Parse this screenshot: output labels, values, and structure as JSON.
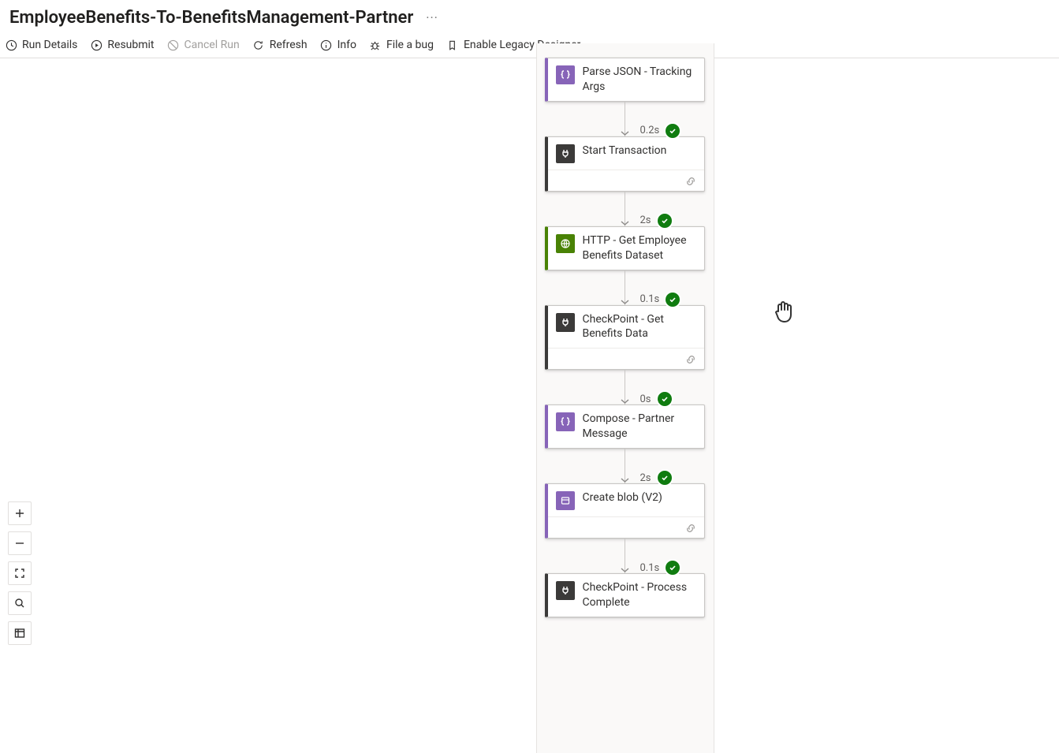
{
  "title": "EmployeeBenefits-To-BenefitsManagement-Partner",
  "toolbar": {
    "run_details": "Run Details",
    "resubmit": "Resubmit",
    "cancel_run": "Cancel Run",
    "refresh": "Refresh",
    "info": "Info",
    "file_bug": "File a bug",
    "enable_legacy": "Enable Legacy Designer"
  },
  "nodes": {
    "n0": {
      "title": "Parse JSON - Tracking Args"
    },
    "n1": {
      "title": "Start Transaction"
    },
    "n2": {
      "title": "HTTP - Get Employee Benefits Dataset"
    },
    "n3": {
      "title": "CheckPoint - Get Benefits Data"
    },
    "n4": {
      "title": "Compose - Partner Message"
    },
    "n5": {
      "title": "Create blob (V2)"
    },
    "n6": {
      "title": "CheckPoint - Process Complete"
    }
  },
  "durations": {
    "d1": "0.2s",
    "d2": "2s",
    "d3": "0.1s",
    "d4": "0s",
    "d5": "2s",
    "d6": "0.1s"
  }
}
